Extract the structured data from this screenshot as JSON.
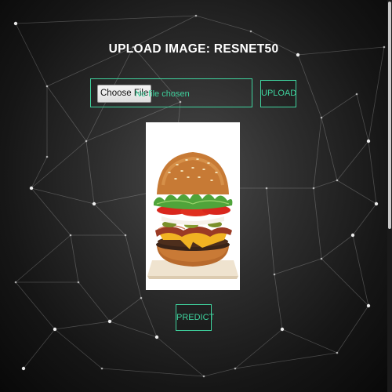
{
  "page": {
    "title": "UPLOAD IMAGE: RESNET50"
  },
  "upload_form": {
    "choose_file_label": "Choose File",
    "file_status": "No file chosen",
    "upload_label": "UPLOAD"
  },
  "preview": {
    "subject": "burger"
  },
  "actions": {
    "predict_label": "PREDICT"
  },
  "colors": {
    "accent": "#3fd39e",
    "background": "#1c1c1c",
    "title": "#ffffff"
  }
}
